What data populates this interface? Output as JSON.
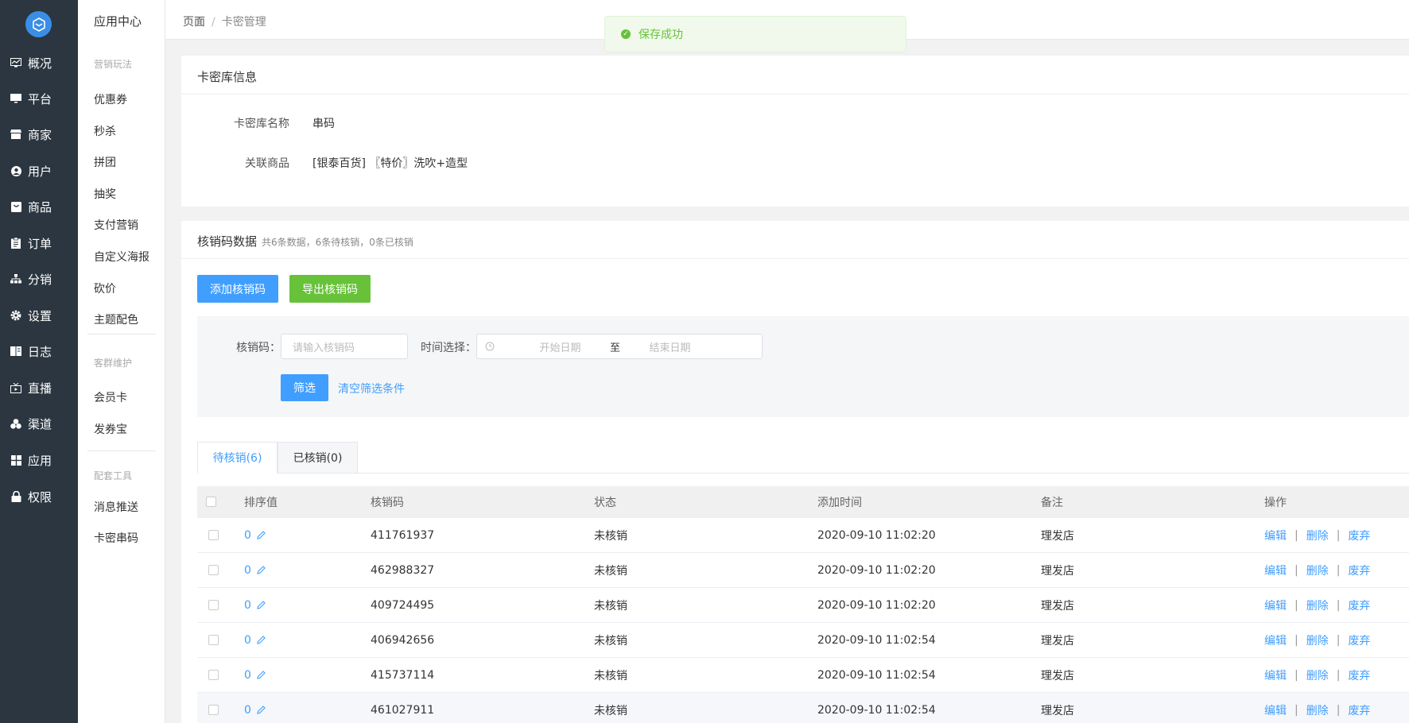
{
  "nav": {
    "items": [
      {
        "label": "概况",
        "icon": "chart-icon"
      },
      {
        "label": "平台",
        "icon": "monitor-icon"
      },
      {
        "label": "商家",
        "icon": "store-icon"
      },
      {
        "label": "用户",
        "icon": "user-icon"
      },
      {
        "label": "商品",
        "icon": "bag-icon"
      },
      {
        "label": "订单",
        "icon": "clipboard-icon"
      },
      {
        "label": "分销",
        "icon": "hierarchy-icon"
      },
      {
        "label": "设置",
        "icon": "gear-icon"
      },
      {
        "label": "日志",
        "icon": "book-icon"
      },
      {
        "label": "直播",
        "icon": "tv-icon"
      },
      {
        "label": "渠道",
        "icon": "cluster-icon"
      },
      {
        "label": "应用",
        "icon": "grid-icon"
      },
      {
        "label": "权限",
        "icon": "lock-icon"
      }
    ]
  },
  "subnav": {
    "title": "应用中心",
    "group1": "营销玩法",
    "group1_items": [
      "优惠券",
      "秒杀",
      "拼团",
      "抽奖",
      "支付营销",
      "自定义海报",
      "砍价",
      "主题配色"
    ],
    "group2": "客群维护",
    "group2_items": [
      "会员卡",
      "发券宝"
    ],
    "group3": "配套工具",
    "group3_items": [
      "消息推送",
      "卡密串码"
    ]
  },
  "breadcrumb": {
    "root": "页面",
    "sep": "/",
    "current": "卡密管理"
  },
  "toast": {
    "text": "保存成功",
    "color": "#67c23a"
  },
  "library": {
    "title": "卡密库信息",
    "name_label": "卡密库名称",
    "name_value": "串码",
    "goods_label": "关联商品",
    "goods_value": "[银泰百货] 〖特价〗洗吹+造型"
  },
  "codes": {
    "title": "核销码数据",
    "summary": "共6条数据，6条待核销，0条已核销",
    "add_button": "添加核销码",
    "export_button": "导出核销码"
  },
  "filter": {
    "code_label": "核销码：",
    "code_placeholder": "请输入核销码",
    "time_label": "时间选择：",
    "start_placeholder": "开始日期",
    "to": "至",
    "end_placeholder": "结束日期",
    "filter_button": "筛选",
    "clear_link": "清空筛选条件"
  },
  "tabs": [
    {
      "label": "待核销(6)",
      "active": true
    },
    {
      "label": "已核销(0)",
      "active": false
    }
  ],
  "table": {
    "headers": [
      "排序值",
      "核销码",
      "状态",
      "添加时间",
      "备注",
      "操作"
    ],
    "ops": [
      "编辑",
      "删除",
      "废弃"
    ],
    "op_sep": "|",
    "rows": [
      {
        "sort": "0",
        "code": "411761937",
        "status": "未核销",
        "time": "2020-09-10 11:02:20",
        "note": "理发店"
      },
      {
        "sort": "0",
        "code": "462988327",
        "status": "未核销",
        "time": "2020-09-10 11:02:20",
        "note": "理发店"
      },
      {
        "sort": "0",
        "code": "409724495",
        "status": "未核销",
        "time": "2020-09-10 11:02:20",
        "note": "理发店"
      },
      {
        "sort": "0",
        "code": "406942656",
        "status": "未核销",
        "time": "2020-09-10 11:02:54",
        "note": "理发店"
      },
      {
        "sort": "0",
        "code": "415737114",
        "status": "未核销",
        "time": "2020-09-10 11:02:54",
        "note": "理发店"
      },
      {
        "sort": "0",
        "code": "461027911",
        "status": "未核销",
        "time": "2020-09-10 11:02:54",
        "note": "理发店"
      }
    ]
  },
  "colors": {
    "primary": "#409eff",
    "success": "#67c23a",
    "sidebar": "#2b3640"
  }
}
